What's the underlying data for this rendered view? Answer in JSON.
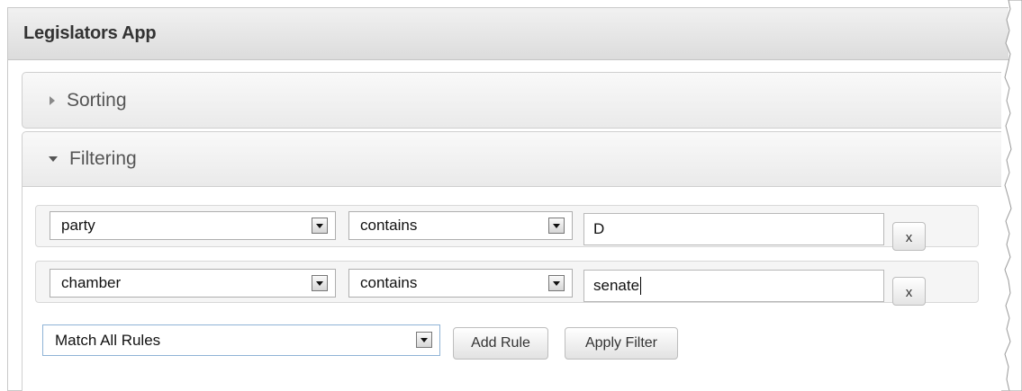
{
  "app": {
    "title": "Legislators App"
  },
  "sections": {
    "sorting": {
      "label": "Sorting",
      "expanded": false
    },
    "filtering": {
      "label": "Filtering",
      "expanded": true
    }
  },
  "filter": {
    "rules": [
      {
        "field": "party",
        "operator": "contains",
        "value": "D",
        "remove_label": "x"
      },
      {
        "field": "chamber",
        "operator": "contains",
        "value": "senate",
        "remove_label": "x"
      }
    ],
    "match_mode": "Match All Rules",
    "add_rule_label": "Add Rule",
    "apply_label": "Apply Filter"
  },
  "icons": {
    "collapsed": "triangle-right-icon",
    "expanded": "triangle-down-icon",
    "dropdown": "chevron-down-icon"
  }
}
